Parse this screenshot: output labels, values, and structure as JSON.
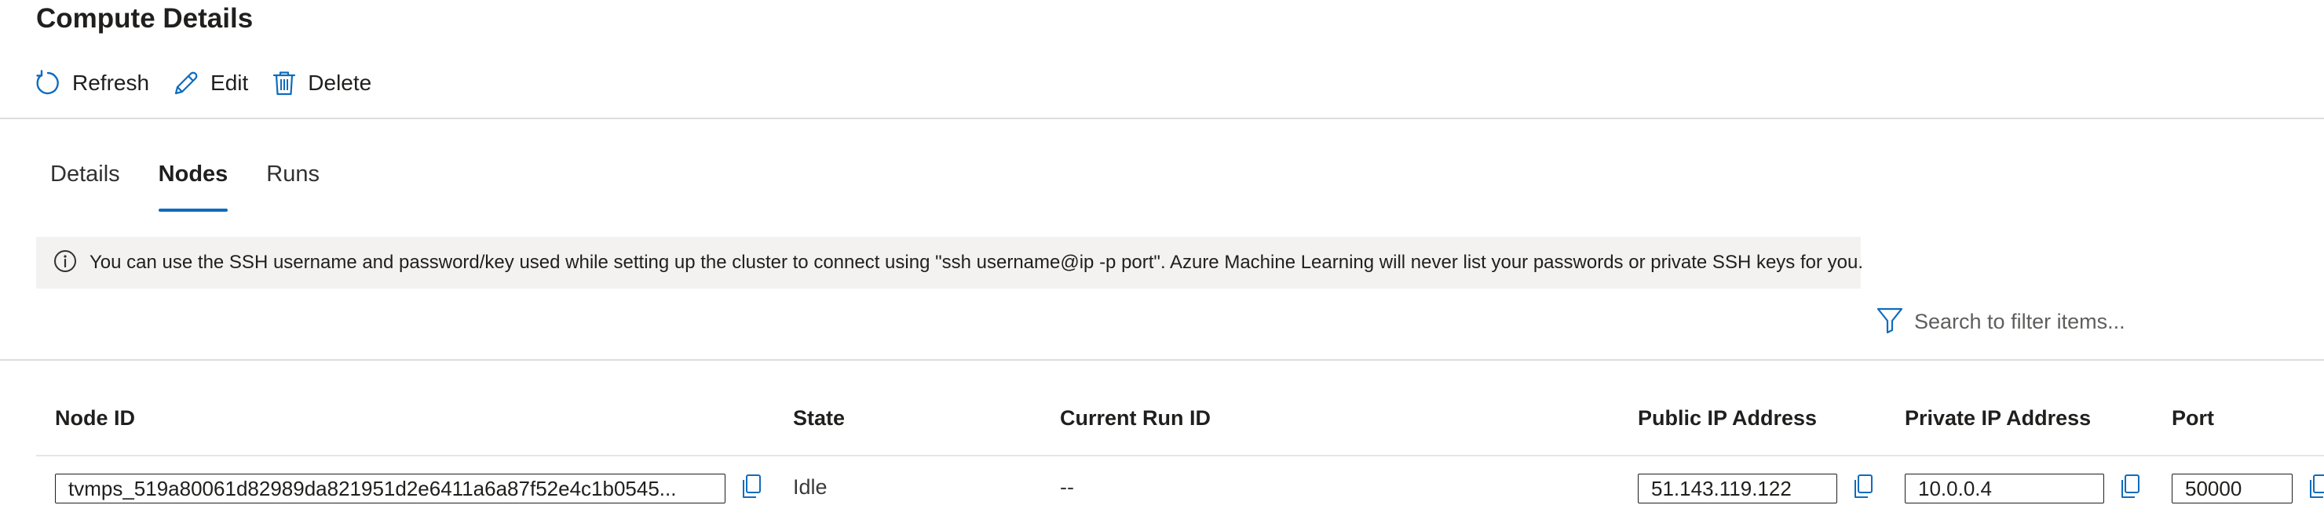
{
  "page": {
    "title": "Compute Details"
  },
  "toolbar": {
    "refresh_label": "Refresh",
    "refresh_icon": "refresh-icon",
    "edit_label": "Edit",
    "edit_icon": "pencil-icon",
    "delete_label": "Delete",
    "delete_icon": "trash-icon"
  },
  "tabs": [
    {
      "label": "Details",
      "active": false
    },
    {
      "label": "Nodes",
      "active": true
    },
    {
      "label": "Runs",
      "active": false
    }
  ],
  "info": {
    "icon": "info-icon",
    "message": "You can use the SSH username and password/key used while setting up the cluster to connect using \"ssh username@ip -p port\". Azure Machine Learning will never list your passwords or private SSH keys for you."
  },
  "filter": {
    "icon": "filter-icon",
    "placeholder": "Search to filter items..."
  },
  "table": {
    "columns": {
      "node_id": "Node ID",
      "state": "State",
      "current_run_id": "Current Run ID",
      "public_ip": "Public IP Address",
      "private_ip": "Private IP Address",
      "port": "Port"
    },
    "rows": [
      {
        "node_id": "tvmps_519a80061d82989da821951d2e6411a6a87f52e4c1b0545...",
        "state": "Idle",
        "current_run_id": "--",
        "public_ip": "51.143.119.122",
        "private_ip": "10.0.0.4",
        "port": "50000"
      }
    ]
  },
  "colors": {
    "accent": "#0f6cbd",
    "icon_blue": "#0f6cbd",
    "info_bar_bg": "#f3f2f1",
    "divider": "#dcdcdc"
  }
}
